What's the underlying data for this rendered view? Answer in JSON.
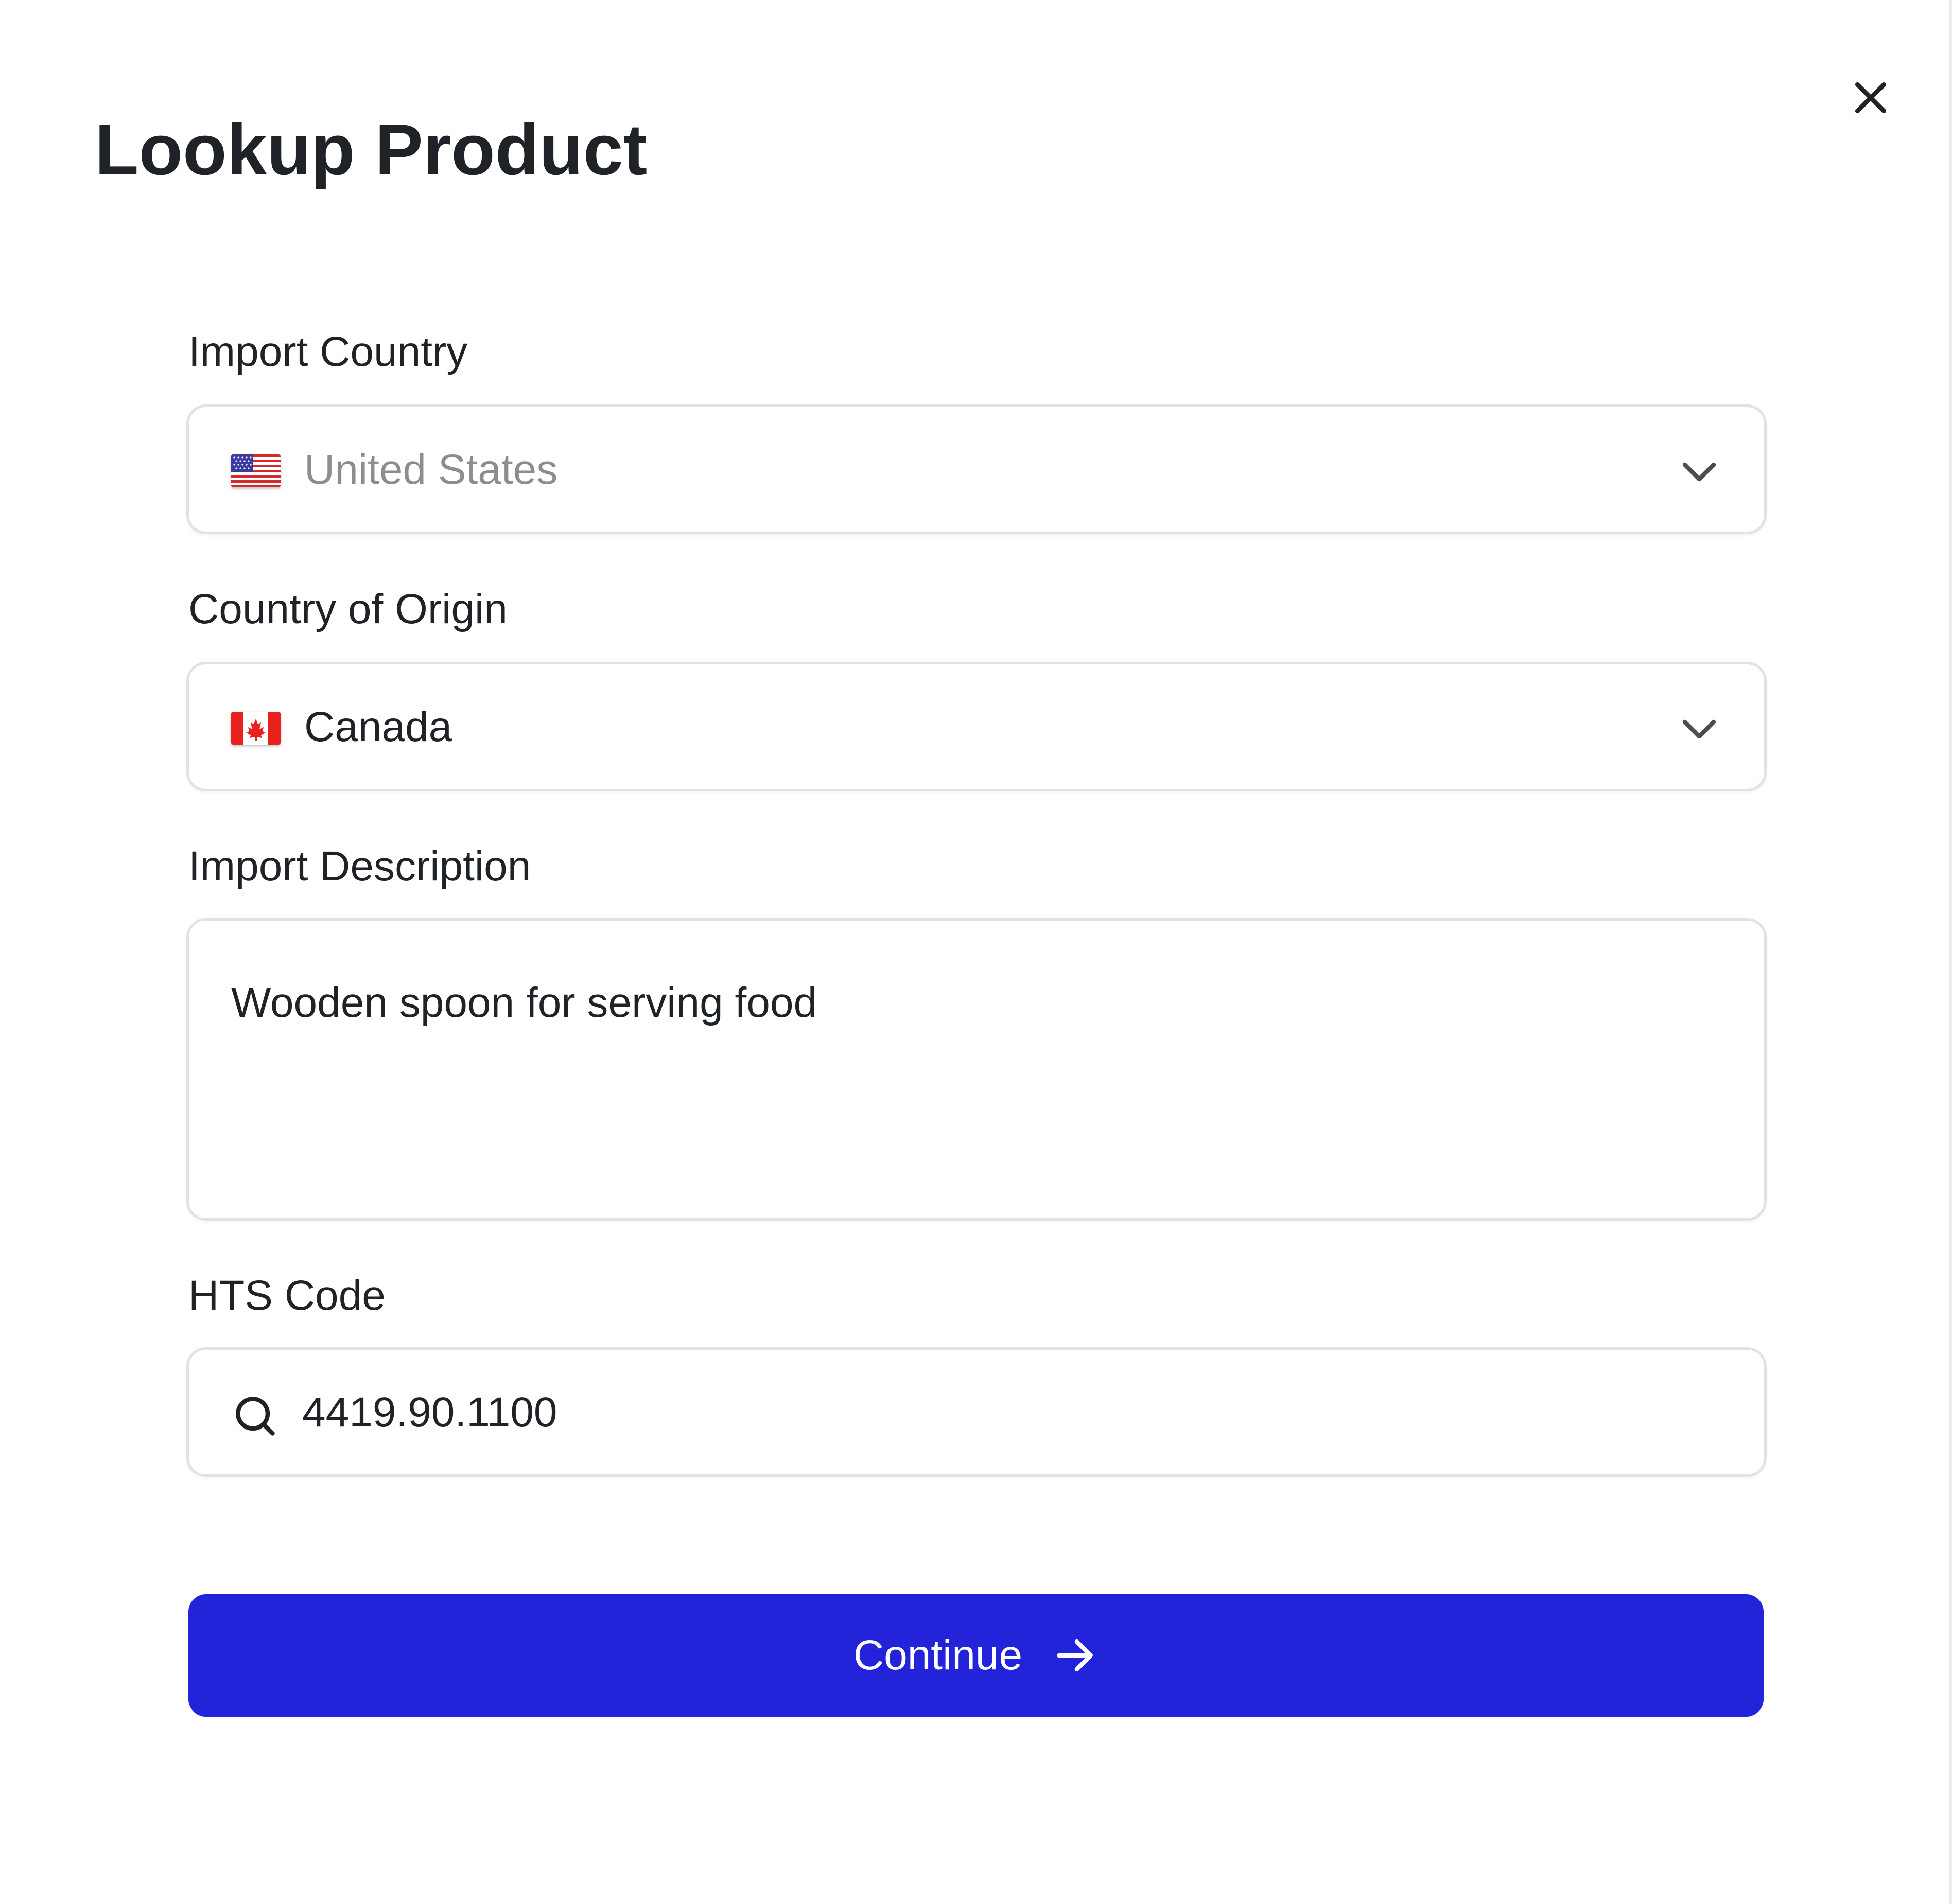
{
  "modal": {
    "title": "Lookup Product",
    "close_icon": "close-icon"
  },
  "import_country": {
    "label": "Import Country",
    "value": "United States",
    "flag_icon": "us-flag-icon",
    "dropdown_icon": "chevron-down-icon"
  },
  "country_of_origin": {
    "label": "Country of Origin",
    "value": "Canada",
    "flag_icon": "canada-flag-icon",
    "dropdown_icon": "chevron-down-icon"
  },
  "import_description": {
    "label": "Import Description",
    "value": "Wooden spoon for serving food"
  },
  "hts_code": {
    "label": "HTS Code",
    "value": "4419.90.1100",
    "search_icon": "search-icon"
  },
  "continue_button": {
    "label": "Continue",
    "icon": "arrow-right-icon",
    "color": "#2323d9"
  },
  "colors": {
    "text": "#1f2328",
    "muted_text": "#8a8d91",
    "border": "#e2e2e4",
    "accent": "#2323d9"
  }
}
